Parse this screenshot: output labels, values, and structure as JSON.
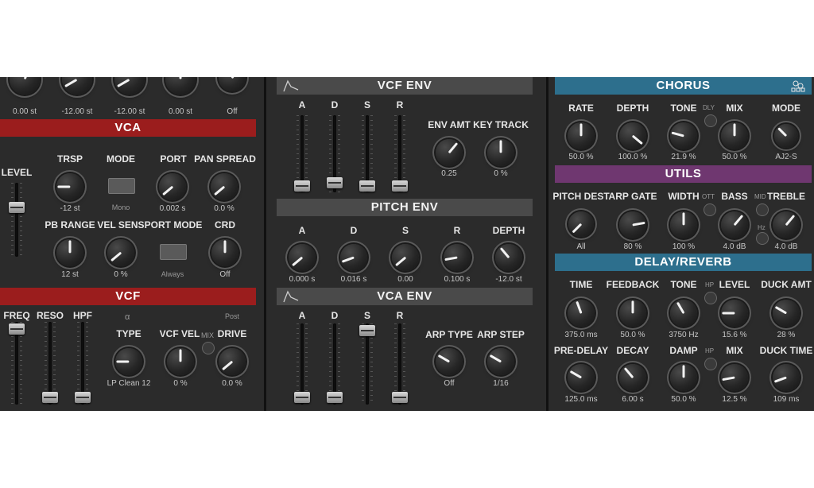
{
  "left": {
    "top_values": [
      "0.00 st",
      "-12.00 st",
      "-12.00 st",
      "0.00 st",
      "Off"
    ],
    "vca": {
      "title": "VCA",
      "level_label": "LEVEL",
      "trsp": {
        "label": "TRSP",
        "value": "-12 st"
      },
      "mode": {
        "label": "MODE",
        "value": "Mono"
      },
      "port": {
        "label": "PORT",
        "value": "0.002 s"
      },
      "pan_spread": {
        "label": "PAN SPREAD",
        "value": "0.0 %"
      },
      "pb_range": {
        "label": "PB RANGE",
        "value": "12 st"
      },
      "vel_sens": {
        "label": "VEL SENS",
        "value": "0 %"
      },
      "port_mode": {
        "label": "PORT MODE",
        "value": "Always"
      },
      "crd": {
        "label": "CRD",
        "value": "Off"
      }
    },
    "vcf": {
      "title": "VCF",
      "freq_label": "FREQ",
      "reso_label": "RESO",
      "hpf_label": "HPF",
      "alpha": "α",
      "type": {
        "label": "TYPE",
        "value": "LP Clean 12"
      },
      "vcf_vel": {
        "label": "VCF VEL",
        "value": "0 %"
      },
      "mix_label": "MIX",
      "post_label": "Post",
      "drive": {
        "label": "DRIVE",
        "value": "0.0 %"
      }
    }
  },
  "middle": {
    "vcf_env": {
      "title": "VCF ENV",
      "sliders": [
        "A",
        "D",
        "S",
        "R"
      ],
      "env_amt": {
        "label": "ENV AMT",
        "value": "0.25"
      },
      "key_track": {
        "label": "KEY TRACK",
        "value": "0 %"
      }
    },
    "pitch_env": {
      "title": "PITCH ENV",
      "knobs": [
        {
          "label": "A",
          "value": "0.000 s"
        },
        {
          "label": "D",
          "value": "0.016 s"
        },
        {
          "label": "S",
          "value": "0.00"
        },
        {
          "label": "R",
          "value": "0.100 s"
        },
        {
          "label": "DEPTH",
          "value": "-12.0 st"
        }
      ]
    },
    "vca_env": {
      "title": "VCA ENV",
      "sliders": [
        "A",
        "D",
        "S",
        "R"
      ],
      "arp_type": {
        "label": "ARP TYPE",
        "value": "Off"
      },
      "arp_step": {
        "label": "ARP STEP",
        "value": "1/16"
      }
    }
  },
  "right": {
    "chorus": {
      "title": "CHORUS",
      "dly_label": "DLY",
      "knobs": [
        {
          "label": "RATE",
          "value": "50.0 %"
        },
        {
          "label": "DEPTH",
          "value": "100.0 %"
        },
        {
          "label": "TONE",
          "value": "21.9 %"
        },
        {
          "label": "MIX",
          "value": "50.0 %"
        },
        {
          "label": "MODE",
          "value": "AJ2-S"
        }
      ]
    },
    "utils": {
      "title": "UTILS",
      "ott_label": "OTT",
      "mid_label": "MID",
      "hz_label": "Hz",
      "knobs": [
        {
          "label": "PITCH DEST",
          "value": "All"
        },
        {
          "label": "ARP GATE",
          "value": "80 %"
        },
        {
          "label": "WIDTH",
          "value": "100 %"
        },
        {
          "label": "BASS",
          "value": "4.0 dB"
        },
        {
          "label": "TREBLE",
          "value": "4.0 dB"
        }
      ]
    },
    "delay_reverb": {
      "title": "DELAY/REVERB",
      "hp_label": "HP",
      "row1": [
        {
          "label": "TIME",
          "value": "375.0 ms"
        },
        {
          "label": "FEEDBACK",
          "value": "50.0 %"
        },
        {
          "label": "TONE",
          "value": "3750 Hz"
        },
        {
          "label": "LEVEL",
          "value": "15.6 %"
        },
        {
          "label": "DUCK AMT",
          "value": "28 %"
        }
      ],
      "row2": [
        {
          "label": "PRE-DELAY",
          "value": "125.0 ms"
        },
        {
          "label": "DECAY",
          "value": "6.00 s"
        },
        {
          "label": "DAMP",
          "value": "50.0 %"
        },
        {
          "label": "MIX",
          "value": "12.5 %"
        },
        {
          "label": "DUCK TIME",
          "value": "109 ms"
        }
      ]
    }
  }
}
